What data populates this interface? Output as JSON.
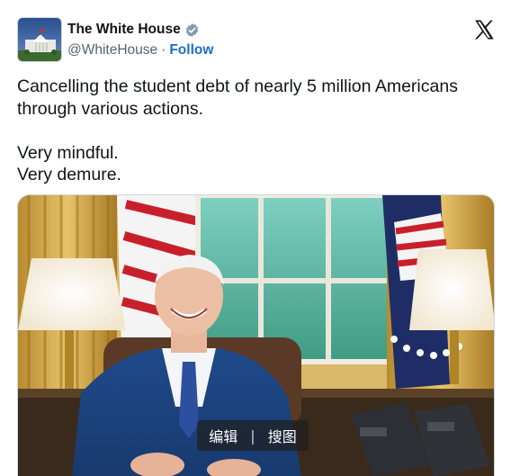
{
  "account": {
    "display_name": "The White House",
    "handle": "@WhiteHouse",
    "separator": "·",
    "follow_label": "Follow",
    "verified": true
  },
  "tweet": {
    "line1": "Cancelling the student debt of nearly 5 million Americans",
    "line2": "through various actions.",
    "line3": "Very mindful.",
    "line4": "Very demure."
  },
  "overlay": {
    "edit_label": "编辑",
    "separator": "|",
    "search_label": "搜图"
  },
  "colors": {
    "accent_link": "#1d6fc4",
    "verified_badge": "#829aab",
    "text": "#0f1419",
    "secondary": "#536471"
  },
  "icons": {
    "verified": "verified-badge-icon",
    "x_logo": "x-logo-icon"
  }
}
